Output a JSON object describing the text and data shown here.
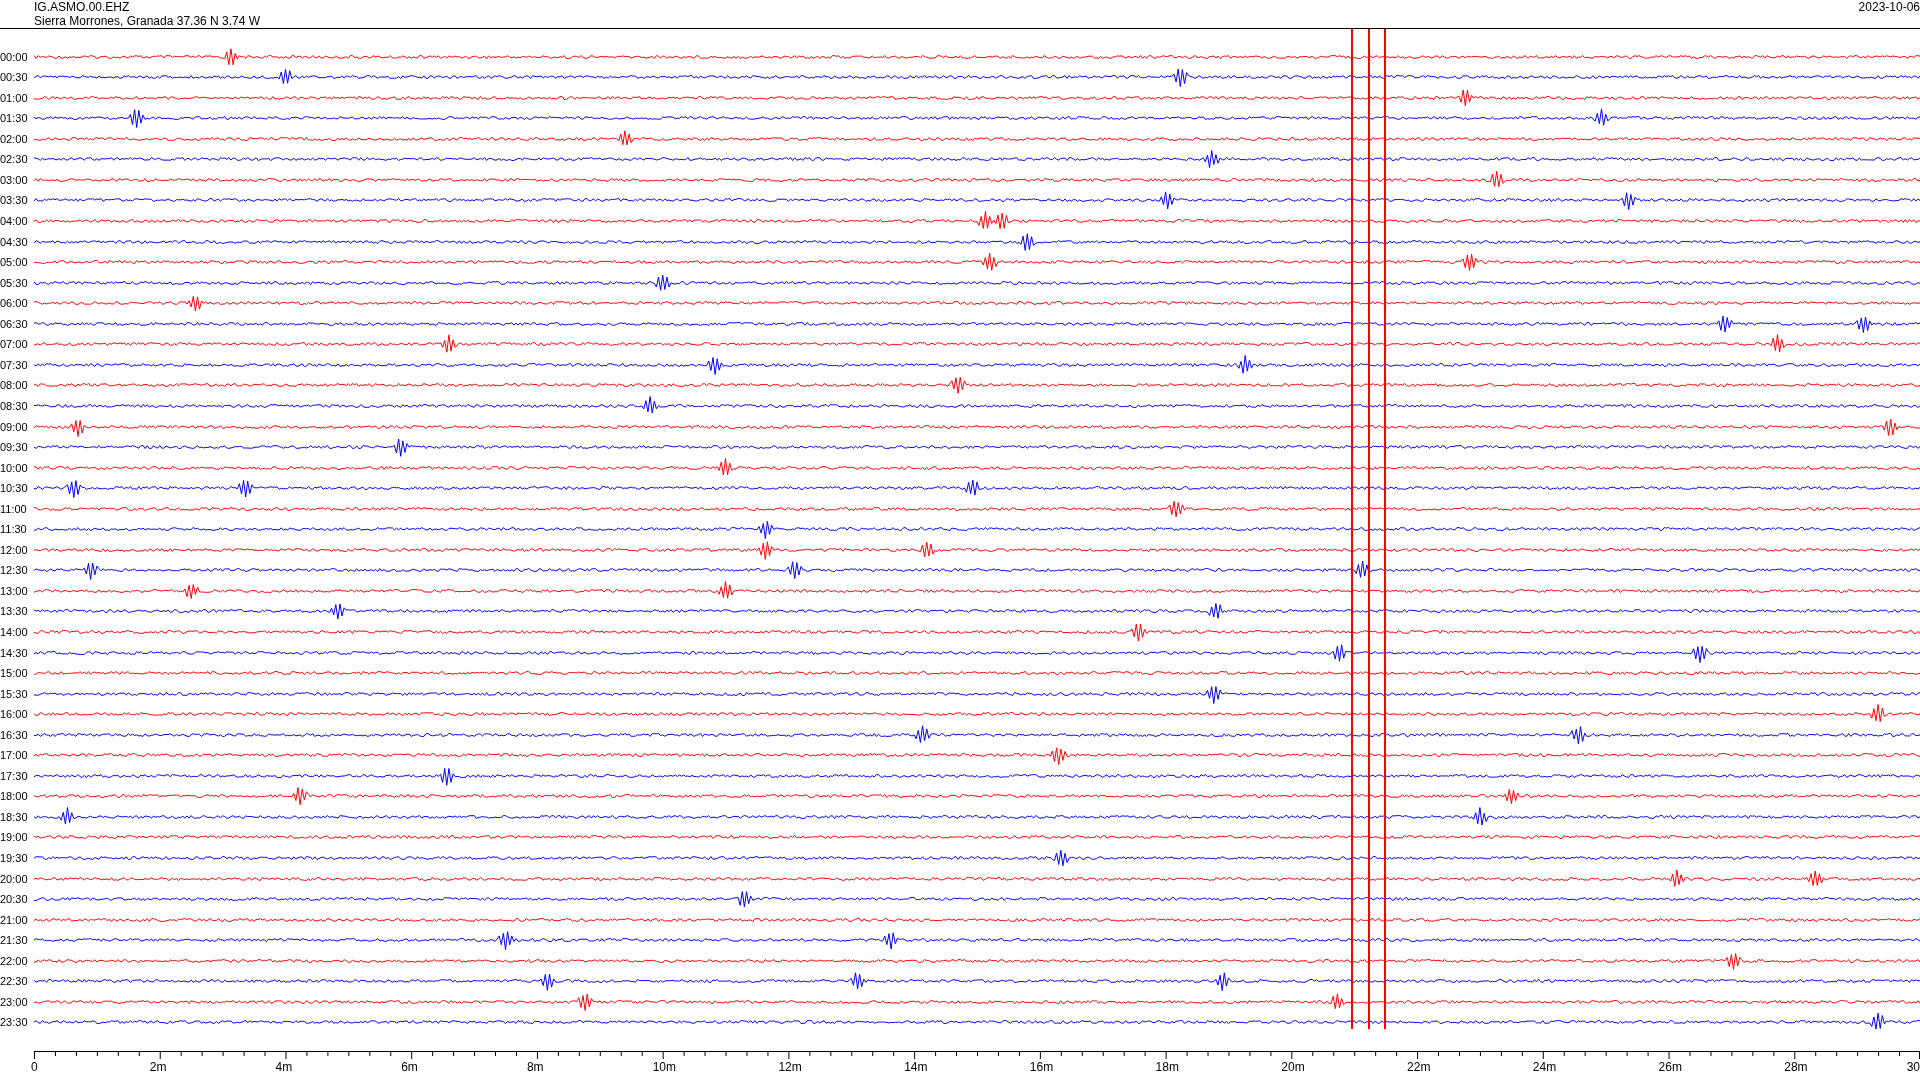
{
  "header": {
    "station": "IG.ASMO.00.EHZ",
    "location": "Sierra Morrones, Granada  37.36 N 3.74 W",
    "date": "2023-10-06"
  },
  "rows": [
    {
      "time": "00:00",
      "color": "#ff0000"
    },
    {
      "time": "00:30",
      "color": "#0000ff"
    },
    {
      "time": "01:00",
      "color": "#ff0000"
    },
    {
      "time": "01:30",
      "color": "#0000ff"
    },
    {
      "time": "02:00",
      "color": "#ff0000"
    },
    {
      "time": "02:30",
      "color": "#0000ff"
    },
    {
      "time": "03:00",
      "color": "#ff0000"
    },
    {
      "time": "03:30",
      "color": "#0000ff"
    },
    {
      "time": "04:00",
      "color": "#ff0000"
    },
    {
      "time": "04:30",
      "color": "#0000ff"
    },
    {
      "time": "05:00",
      "color": "#ff0000"
    },
    {
      "time": "05:30",
      "color": "#0000ff"
    },
    {
      "time": "06:00",
      "color": "#ff0000"
    },
    {
      "time": "06:30",
      "color": "#0000ff"
    },
    {
      "time": "07:00",
      "color": "#ff0000"
    },
    {
      "time": "07:30",
      "color": "#0000ff"
    },
    {
      "time": "08:00",
      "color": "#ff0000"
    },
    {
      "time": "08:30",
      "color": "#0000ff"
    },
    {
      "time": "09:00",
      "color": "#ff0000"
    },
    {
      "time": "09:30",
      "color": "#0000ff"
    },
    {
      "time": "10:00",
      "color": "#ff0000"
    },
    {
      "time": "10:30",
      "color": "#0000ff"
    },
    {
      "time": "11:00",
      "color": "#ff0000"
    },
    {
      "time": "11:30",
      "color": "#0000ff"
    },
    {
      "time": "12:00",
      "color": "#ff0000"
    },
    {
      "time": "12:30",
      "color": "#0000ff"
    },
    {
      "time": "13:00",
      "color": "#ff0000"
    },
    {
      "time": "13:30",
      "color": "#0000ff"
    },
    {
      "time": "14:00",
      "color": "#ff0000"
    },
    {
      "time": "14:30",
      "color": "#0000ff"
    },
    {
      "time": "15:00",
      "color": "#ff0000"
    },
    {
      "time": "15:30",
      "color": "#0000ff"
    },
    {
      "time": "16:00",
      "color": "#ff0000"
    },
    {
      "time": "16:30",
      "color": "#0000ff"
    },
    {
      "time": "17:00",
      "color": "#ff0000"
    },
    {
      "time": "17:30",
      "color": "#0000ff"
    },
    {
      "time": "18:00",
      "color": "#ff0000"
    },
    {
      "time": "18:30",
      "color": "#0000ff"
    },
    {
      "time": "19:00",
      "color": "#ff0000"
    },
    {
      "time": "19:30",
      "color": "#0000ff"
    },
    {
      "time": "20:00",
      "color": "#ff0000"
    },
    {
      "time": "20:30",
      "color": "#0000ff"
    },
    {
      "time": "21:00",
      "color": "#ff0000"
    },
    {
      "time": "21:30",
      "color": "#0000ff"
    },
    {
      "time": "22:00",
      "color": "#ff0000"
    },
    {
      "time": "22:30",
      "color": "#0000ff"
    },
    {
      "time": "23:00",
      "color": "#ff0000"
    },
    {
      "time": "23:30",
      "color": "#0000ff"
    }
  ],
  "x_axis": {
    "labels": [
      "0",
      "2m",
      "4m",
      "6m",
      "8m",
      "10m",
      "12m",
      "14m",
      "16m",
      "18m",
      "20m",
      "22m",
      "24m",
      "26m",
      "28m",
      "30"
    ]
  }
}
